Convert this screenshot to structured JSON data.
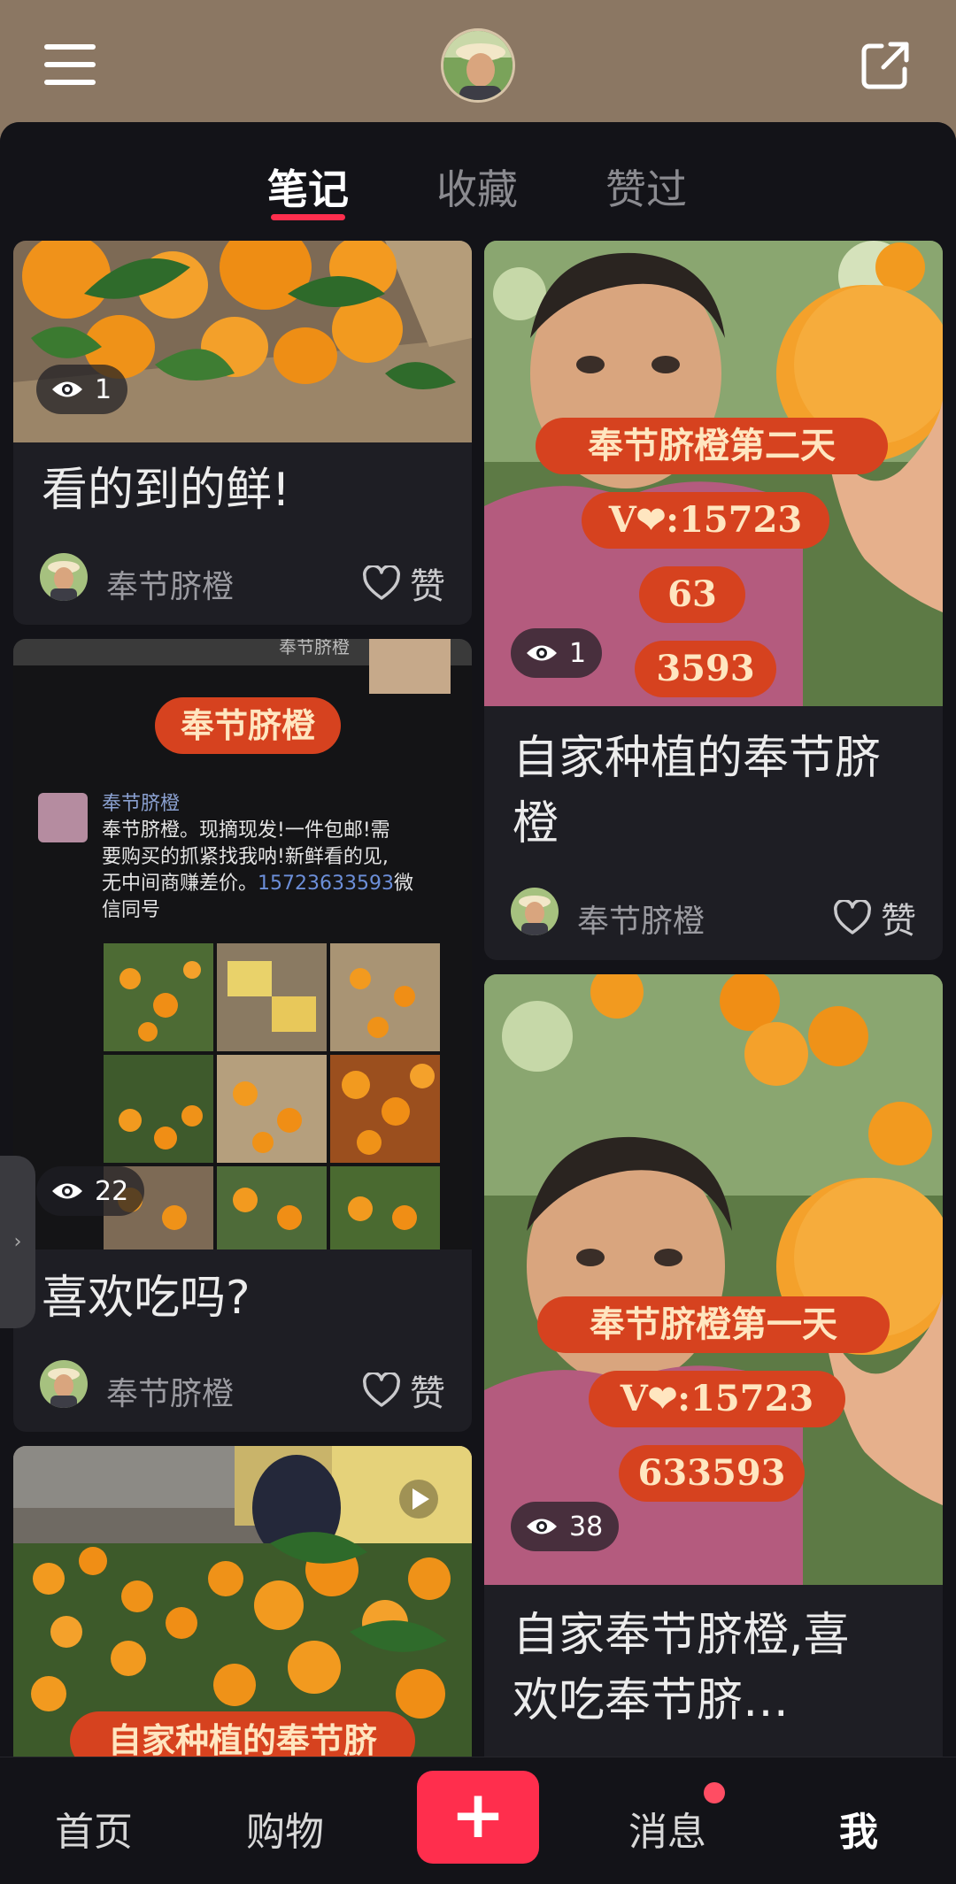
{
  "tabs": [
    {
      "label": "笔记"
    },
    {
      "label": "收藏"
    },
    {
      "label": "赞过"
    }
  ],
  "cards_left": [
    {
      "title": "看的到的鲜!",
      "author": "奉节脐橙",
      "like_label": "赞",
      "views": "1"
    },
    {
      "title": "喜欢吃吗?",
      "author": "奉节脐橙",
      "like_label": "赞",
      "views": "22",
      "screenshot": {
        "banner": "奉节脐橙",
        "header_text": "奉节脐橙",
        "post_author": "奉节脐橙",
        "post_text_1": "奉节脐橙。现摘现发!一件包邮!需",
        "post_text_2": "要购买的抓紧找我呐!新鲜看的见,",
        "post_text_3": "无中间商赚差价。",
        "post_phone": "15723633593",
        "post_text_4": "微",
        "post_text_5": "信同号"
      }
    },
    {
      "caption": "自家种植的奉节脐"
    }
  ],
  "cards_right": [
    {
      "title": "自家种植的奉节脐橙",
      "author": "奉节脐橙",
      "like_label": "赞",
      "views": "1",
      "captions": [
        "奉节脐橙第二天",
        "V❤:15723",
        "63",
        "3593"
      ]
    },
    {
      "title": "自家奉节脐橙,喜欢吃奉节脐…",
      "views": "38",
      "captions": [
        "奉节脐橙第一天",
        "V❤:15723",
        "633593"
      ]
    }
  ],
  "bottom_nav": {
    "home": "首页",
    "shop": "购物",
    "plus": "+",
    "messages": "消息",
    "me": "我"
  },
  "colors": {
    "accent": "#ff2e4d",
    "header_bg": "#8b7763",
    "panel_bg": "#131318",
    "card_bg": "#1e1e24",
    "caption_bg": "#d6421f"
  }
}
